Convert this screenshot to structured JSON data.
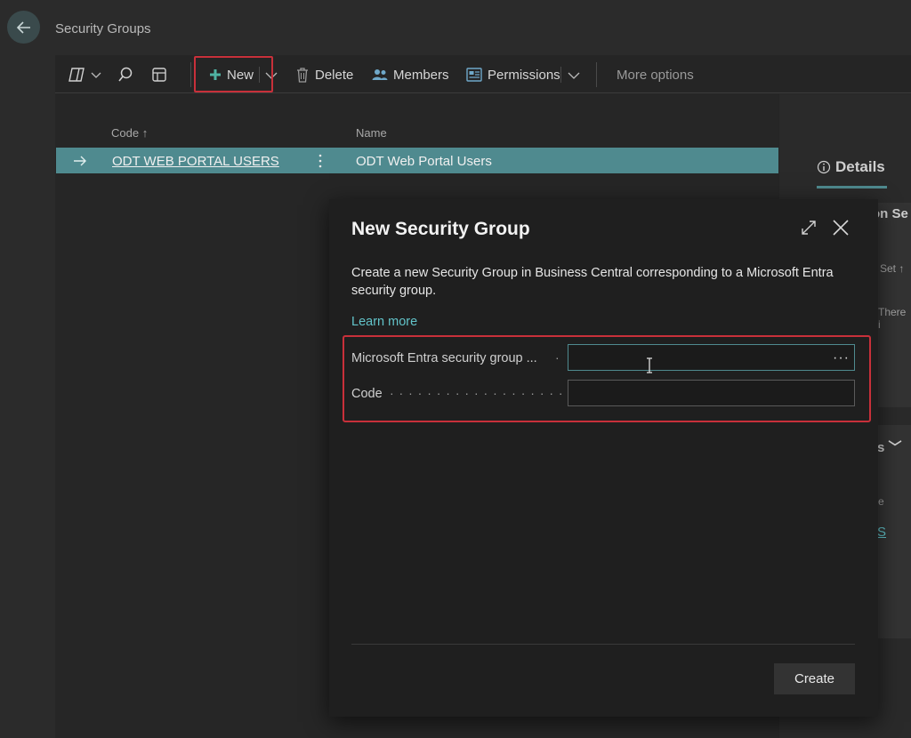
{
  "page": {
    "title": "Security Groups"
  },
  "toolbar": {
    "new_label": "New",
    "delete_label": "Delete",
    "members_label": "Members",
    "permissions_label": "Permissions",
    "more_options_label": "More options"
  },
  "list": {
    "columns": {
      "code": "Code ↑",
      "name": "Name"
    },
    "rows": [
      {
        "code": "ODT WEB PORTAL USERS",
        "name": "ODT Web Portal Users"
      }
    ]
  },
  "right_pane": {
    "details_tab": "Details",
    "partial_1": "on Se",
    "partial_2": "Set ↑",
    "partial_3": "There i",
    "partial_4": "s",
    "partial_5": "e",
    "partial_6": "S"
  },
  "dialog": {
    "title": "New Security Group",
    "description": "Create a new Security Group in Business Central corresponding to a Microsoft Entra security group.",
    "learn_more": "Learn more",
    "fields": [
      {
        "label": "Microsoft Entra security group ...",
        "value": ""
      },
      {
        "label": "Code",
        "value": ""
      }
    ],
    "create_label": "Create"
  },
  "colors": {
    "accent": "#4f8a8f",
    "link": "#62c3c9",
    "highlight": "#c8303a"
  }
}
